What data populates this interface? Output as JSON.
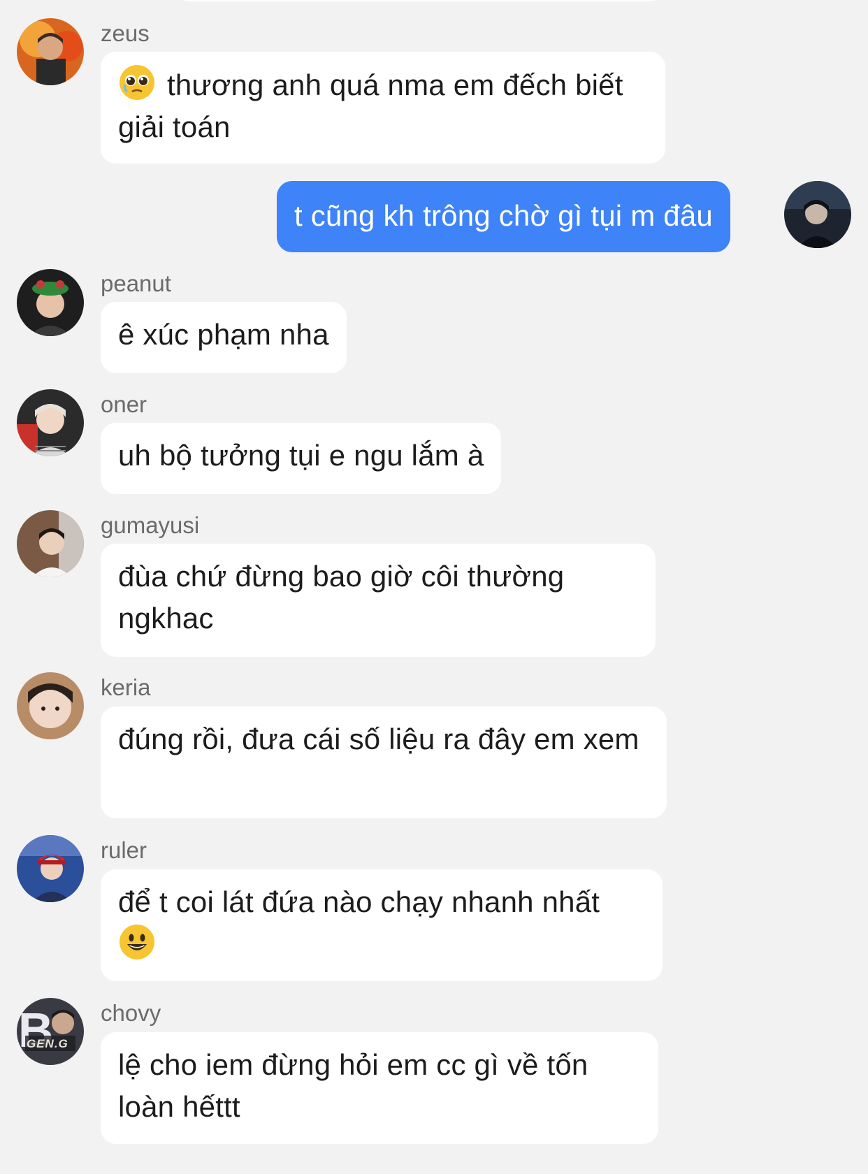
{
  "messages": [
    {
      "sender": "zeus",
      "emoji": "pleading-face-emoji",
      "text": "thương anh quá nma em đếch biết giải toán"
    },
    {
      "sender": "",
      "mine": true,
      "text": "t cũng kh trông chờ gì tụi m đâu"
    },
    {
      "sender": "peanut",
      "text": "ê xúc phạm nha"
    },
    {
      "sender": "oner",
      "text": "uh bộ tưởng tụi e ngu lắm à"
    },
    {
      "sender": "gumayusi",
      "text": "đùa chứ đừng bao giờ côi thường ngkhac"
    },
    {
      "sender": "keria",
      "text": "đúng rồi, đưa cái số liệu ra đây em xem"
    },
    {
      "sender": "ruler",
      "text": "để t coi lát đứa nào chạy nhanh nhất",
      "emoji_after": "smiling-face-emoji"
    },
    {
      "sender": "chovy",
      "text": "lệ cho iem đừng hỏi em cc gì về tốn loàn hếttt"
    }
  ],
  "avatar_badges": {
    "chovy": "GEN.G"
  },
  "colors": {
    "background": "#f2f2f2",
    "incoming_bubble": "#ffffff",
    "outgoing_bubble": "#3f83f8"
  }
}
